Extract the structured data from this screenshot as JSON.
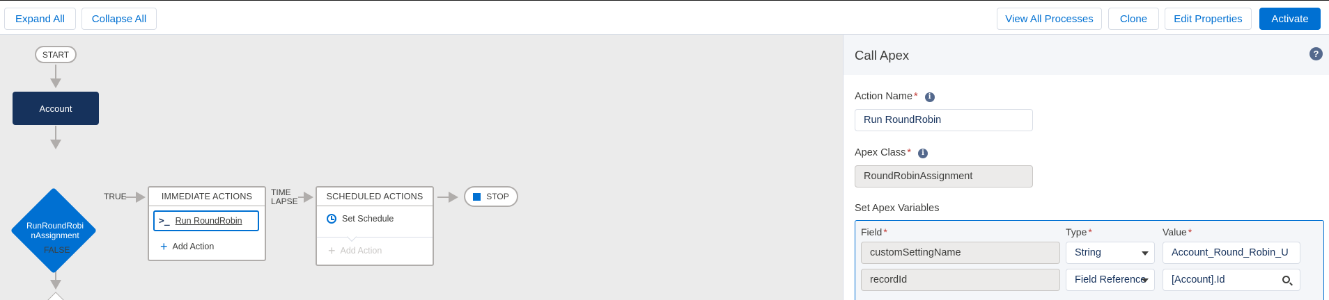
{
  "toolbar": {
    "expand_all": "Expand All",
    "collapse_all": "Collapse All",
    "view_all_processes": "View All Processes",
    "clone": "Clone",
    "edit_properties": "Edit Properties",
    "activate": "Activate"
  },
  "canvas": {
    "start": "START",
    "object": "Account",
    "criteria": "RunRoundRobinAssignment",
    "criteria_line1": "RunRoundRobi",
    "criteria_line2": "nAssignment",
    "true_label": "TRUE",
    "false_label": "FALSE",
    "time_lapse_line1": "TIME",
    "time_lapse_line2": "LAPSE",
    "immediate_actions": {
      "header": "IMMEDIATE ACTIONS",
      "action_label": "Run RoundRobin",
      "add_action": "Add Action"
    },
    "scheduled_actions": {
      "header": "SCHEDULED ACTIONS",
      "set_schedule": "Set Schedule",
      "add_action": "Add Action"
    },
    "stop": "STOP"
  },
  "panel": {
    "title": "Call Apex",
    "action_name_label": "Action Name",
    "action_name_value": "Run RoundRobin",
    "apex_class_label": "Apex Class",
    "apex_class_value": "RoundRobinAssignment",
    "set_vars_label": "Set Apex Variables",
    "columns": {
      "field": "Field",
      "type": "Type",
      "value": "Value"
    },
    "rows": [
      {
        "field": "customSettingName",
        "type": "String",
        "value": "Account_Round_Robin_U"
      },
      {
        "field": "recordId",
        "type": "Field Reference",
        "value": "[Account].Id"
      }
    ]
  },
  "colors": {
    "brand": "#0070d2",
    "object_node": "#16325c",
    "canvas_bg": "#ebebeb",
    "required": "#c23934"
  }
}
